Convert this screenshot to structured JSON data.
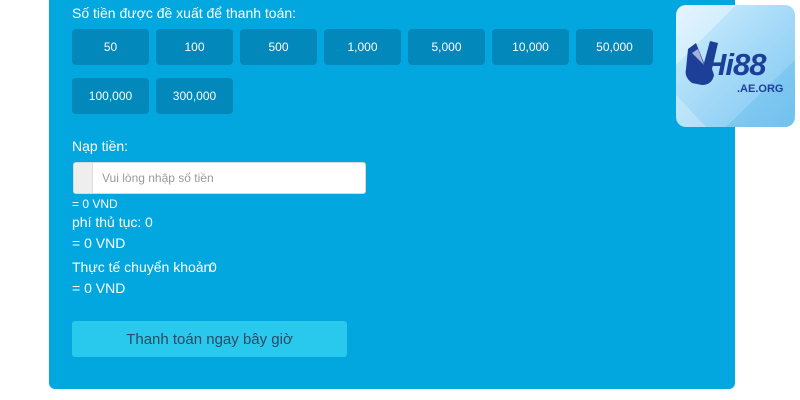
{
  "suggested": {
    "title": "Số tiền được đề xuất để thanh toán:",
    "amounts": [
      "50",
      "100",
      "500",
      "1,000",
      "5,000",
      "10,000",
      "50,000",
      "100,000",
      "300,000"
    ]
  },
  "deposit": {
    "label": "Nạp tiền:",
    "placeholder": "Vui lòng nhập số tiền",
    "value": "",
    "converted": "= 0 VND"
  },
  "fee": {
    "label": "phí thủ tục:",
    "value": "0",
    "converted": "= 0 VND"
  },
  "actual": {
    "label": "Thực tế chuyển khoản:",
    "value": "0",
    "converted": "= 0 VND"
  },
  "submit_label": "Thanh toán ngay bây giờ",
  "logo": {
    "text": "Hi88",
    "sub": ".AE.ORG"
  },
  "colors": {
    "panel": "#02a7e0",
    "amount_button": "#0288bb",
    "submit_button": "#29c9ee"
  }
}
